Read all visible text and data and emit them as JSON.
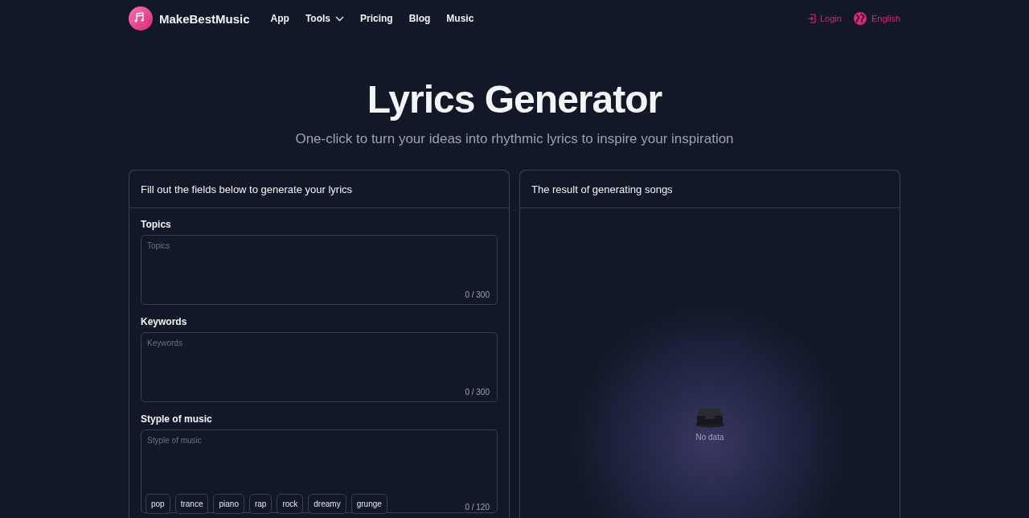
{
  "header": {
    "brand": "MakeBestMusic",
    "nav": [
      {
        "label": "App",
        "dropdown": false
      },
      {
        "label": "Tools",
        "dropdown": true
      },
      {
        "label": "Pricing",
        "dropdown": false
      },
      {
        "label": "Blog",
        "dropdown": false
      },
      {
        "label": "Music",
        "dropdown": false
      }
    ],
    "login": "Login",
    "language": "English"
  },
  "hero": {
    "title": "Lyrics Generator",
    "subtitle": "One-click to turn your ideas into rhythmic lyrics to inspire your inspiration"
  },
  "form_card": {
    "title": "Fill out the fields below to generate your lyrics",
    "fields": [
      {
        "label": "Topics",
        "placeholder": "Topics",
        "counter": "0 / 300"
      },
      {
        "label": "Keywords",
        "placeholder": "Keywords",
        "counter": "0 / 300"
      },
      {
        "label": "Styple of music",
        "placeholder": "Styple of music",
        "counter": "0 / 120",
        "tags": [
          "pop",
          "trance",
          "piano",
          "rap",
          "rock",
          "dreamy",
          "grunge"
        ]
      }
    ]
  },
  "result_card": {
    "title": "The result of generating songs",
    "empty_text": "No data"
  }
}
